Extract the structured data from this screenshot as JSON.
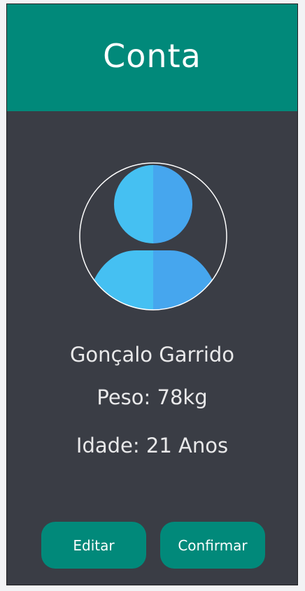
{
  "header": {
    "title": "Conta"
  },
  "profile": {
    "avatar_icon": "user-avatar-icon",
    "name": "Gonçalo Garrido",
    "weight": "Peso: 78kg",
    "age": "Idade: 21 Anos"
  },
  "actions": {
    "edit_label": "Editar",
    "confirm_label": "Confirmar"
  },
  "colors": {
    "accent": "#01897a",
    "background": "#3a3d45",
    "avatar_light": "#45c0f2",
    "avatar_dark": "#46a6ee"
  }
}
